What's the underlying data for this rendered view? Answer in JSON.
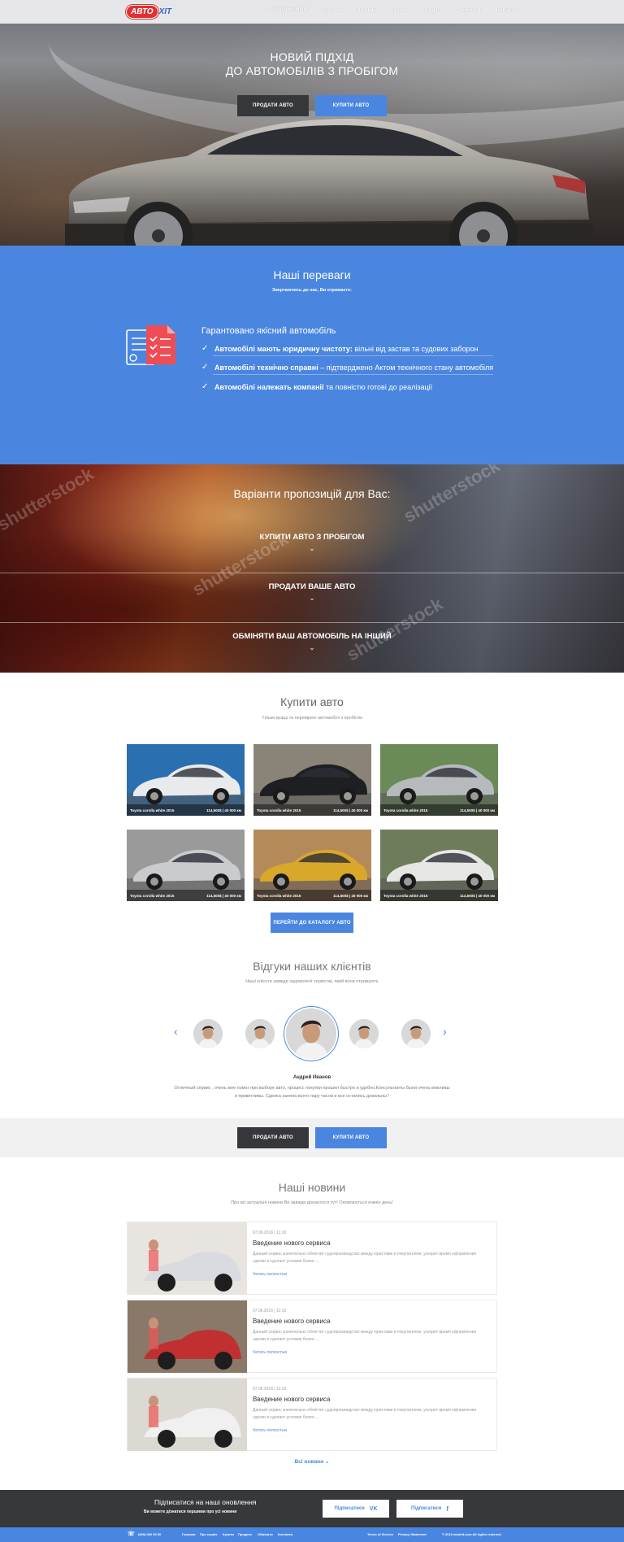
{
  "header": {
    "logo_part1": "АВТО",
    "logo_part2": "ХІТ",
    "phone": "+ (000) 000 00 00",
    "nav": [
      "Головна",
      "Про нас",
      "Купити",
      "Продати",
      "Обміняти",
      "Контакти"
    ]
  },
  "hero": {
    "title_line1": "НОВИЙ ПІДХІД",
    "title_line2": "ДО АВТОМОБІЛІВ З ПРОБІГОМ",
    "sell_button": "ПРОДАТИ АВТО",
    "buy_button": "КУПИТИ АВТО"
  },
  "advantages": {
    "title": "Наші переваги",
    "subtitle": "Звертаючись до нас, Ви отримаєте:",
    "heading": "Гарантовано якісний автомобіль",
    "items": [
      {
        "bold": "Автомобілі мають юридичну чистоту:",
        "rest": " вільні від застав та судових заборон"
      },
      {
        "bold": "Автомобілі технічно справні",
        "rest": " – підтверджено Актом технічного стану автомобіля"
      },
      {
        "bold": "Автомобілі належать компанії",
        "rest": " та повністю готові до реалізації"
      }
    ]
  },
  "offers": {
    "title": "Варіанти пропозицій для Вас:",
    "items": [
      "КУПИТИ АВТО З ПРОБІГОМ",
      "ПРОДАТИ ВАШЕ АВТО",
      "ОБМІНЯТИ ВАШ АВТОМОБІЛЬ НА ІНШИЙ"
    ],
    "watermark": "shutterstock"
  },
  "buy": {
    "title": "Купити авто",
    "subtitle": "Тільки кращі та перевірені автомобілі з пробігом",
    "cars": [
      {
        "name": "Toyota corolla white 2015",
        "info": "114,500$ | 40 000 км",
        "color": "#e8eaec",
        "bg": "#2a6fb0"
      },
      {
        "name": "Toyota corolla white 2015",
        "info": "114,500$ | 40 000 км",
        "color": "#1e1f22",
        "bg": "#8a8478"
      },
      {
        "name": "Toyota corolla white 2015",
        "info": "114,500$ | 40 000 км",
        "color": "#b7babd",
        "bg": "#6a8a58"
      },
      {
        "name": "Toyota corolla white 2015",
        "info": "114,500$ | 40 000 км",
        "color": "#c9cbce",
        "bg": "#9a9a9a"
      },
      {
        "name": "Toyota corolla white 2015",
        "info": "114,500$ | 40 000 км",
        "color": "#d9a72a",
        "bg": "#b58a5a"
      },
      {
        "name": "Toyota corolla white 2015",
        "info": "114,500$ | 40 000 км",
        "color": "#e6e6e4",
        "bg": "#6f7c5c"
      }
    ],
    "catalog_button": "ПЕРЕЙТИ ДО КАТАЛОГУ АВТО"
  },
  "reviews": {
    "title": "Відгуки наших клієнтів",
    "subtitle": "Наші клієнти завжди задоволені сервісом, який вони отримують",
    "name": "Андрей Иванов",
    "text": "Отличный сервис , очень мне помог при выборе авто, процесс покупки прошел быстро и удобно.Консультанты были очень вежливы и приветливы. Сделка заняла всего пару часов и все остались довольны !"
  },
  "cta": {
    "sell_button": "ПРОДАТИ АВТО",
    "buy_button": "КУПИТИ АВТО"
  },
  "news": {
    "title": "Наші новини",
    "subtitle": "Про всі актуальні новини Ви завжди дізнаєтеся тут! Оновлюється кожен день!",
    "items": [
      {
        "date": "07.06.2016 | 11:10",
        "heading": "Введение нового сервиса",
        "text": "Данный сервис значительно облегчит судопроизводство между юристами и покупателем, ускорит время оформления сделки и сделает условия более ...",
        "more": "Читать полностью"
      },
      {
        "date": "07.06.2016 | 11:10",
        "heading": "Введение нового сервиса",
        "text": "Данный сервис значительно облегчит судопроизводство между юристами и покупателем, ускорит время оформления сделки и сделает условия более ...",
        "more": "Читать полностью"
      },
      {
        "date": "07.06.2016 | 11:10",
        "heading": "Введение нового сервиса",
        "text": "Данный сервис значительно облегчит судопроизводство между юристами и покупателем, ускорит время оформления сделки и сделает условия более ...",
        "more": "Читать полностью"
      }
    ],
    "all_news": "Всі новини"
  },
  "subscribe": {
    "title": "Підписатися на наші оновлення",
    "subtitle": "Ви можете дізнатися першими про усі новини",
    "vk_button": "Підписатися",
    "fb_button": "Підписатися"
  },
  "footer": {
    "phone": "(000) 000 00 00",
    "nav": [
      "Головна",
      "Про сервіс",
      "Купити",
      "Продати",
      "Обміняти",
      "Контакти"
    ],
    "terms": "Terms of Service",
    "privacy": "Privacy Statement",
    "copyright": "© 2016 avtohit.com All rights reserved"
  },
  "colors": {
    "accent": "#4a86e0",
    "dark_button": "#36373b",
    "footer_dark": "#37383c"
  }
}
